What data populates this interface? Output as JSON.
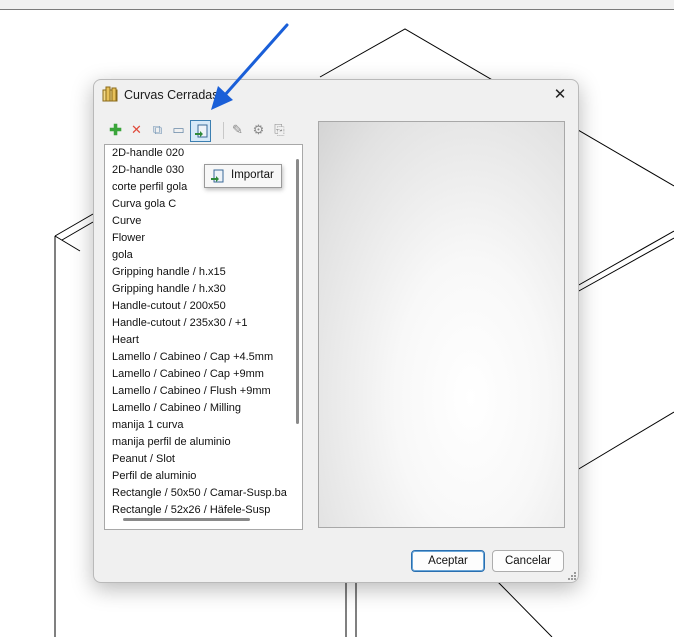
{
  "dialog": {
    "title": "Curvas Cerradas",
    "close_glyph": "✕"
  },
  "toolbar": {
    "items": [
      {
        "icon": "add-icon",
        "glyph": "✚",
        "color": "#3aa53a",
        "state": "enabled"
      },
      {
        "icon": "delete-icon",
        "glyph": "✕",
        "color": "#e04a3a",
        "state": "disabled"
      },
      {
        "icon": "copy-icon",
        "glyph": "⧉",
        "color": "#7a9ab8",
        "state": "disabled"
      },
      {
        "icon": "rename-icon",
        "glyph": "▭",
        "color": "#6a8aa8",
        "state": "disabled"
      },
      {
        "icon": "import-icon",
        "glyph": "⇲",
        "color": "#3a6a98",
        "state": "active"
      },
      {
        "icon": "edit-icon",
        "glyph": "✎",
        "color": "#8a8a8a",
        "state": "disabled"
      },
      {
        "icon": "settings-icon",
        "glyph": "⚙",
        "color": "#8a8a8a",
        "state": "disabled"
      },
      {
        "icon": "export-icon",
        "glyph": "⎘",
        "color": "#8a8a8a",
        "state": "disabled"
      }
    ]
  },
  "tooltip": {
    "label": "Importar",
    "icon": "import-icon"
  },
  "curves": [
    "2D-handle 020",
    "2D-handle 030",
    "corte perfil gola",
    "Curva gola C",
    "Curve",
    "Flower",
    "gola",
    "Gripping handle / h.x15",
    "Gripping handle / h.x30",
    "Handle-cutout / 200x50",
    "Handle-cutout / 235x30 / +1",
    "Heart",
    "Lamello / Cabineo / Cap +4.5mm",
    "Lamello / Cabineo / Cap +9mm",
    "Lamello / Cabineo / Flush +9mm",
    "Lamello / Cabineo / Milling",
    "manija 1 curva",
    "manija perfil de aluminio",
    "Peanut / Slot",
    "Perfil de aluminio",
    "Rectangle / 50x50 / Camar-Susp.ba",
    "Rectangle / 52x26 / Häfele-Susp"
  ],
  "buttons": {
    "accept": "Aceptar",
    "cancel": "Cancelar"
  },
  "colors": {
    "annotation_arrow": "#1a5fd8",
    "primary_button_border": "#2a6fb0"
  }
}
